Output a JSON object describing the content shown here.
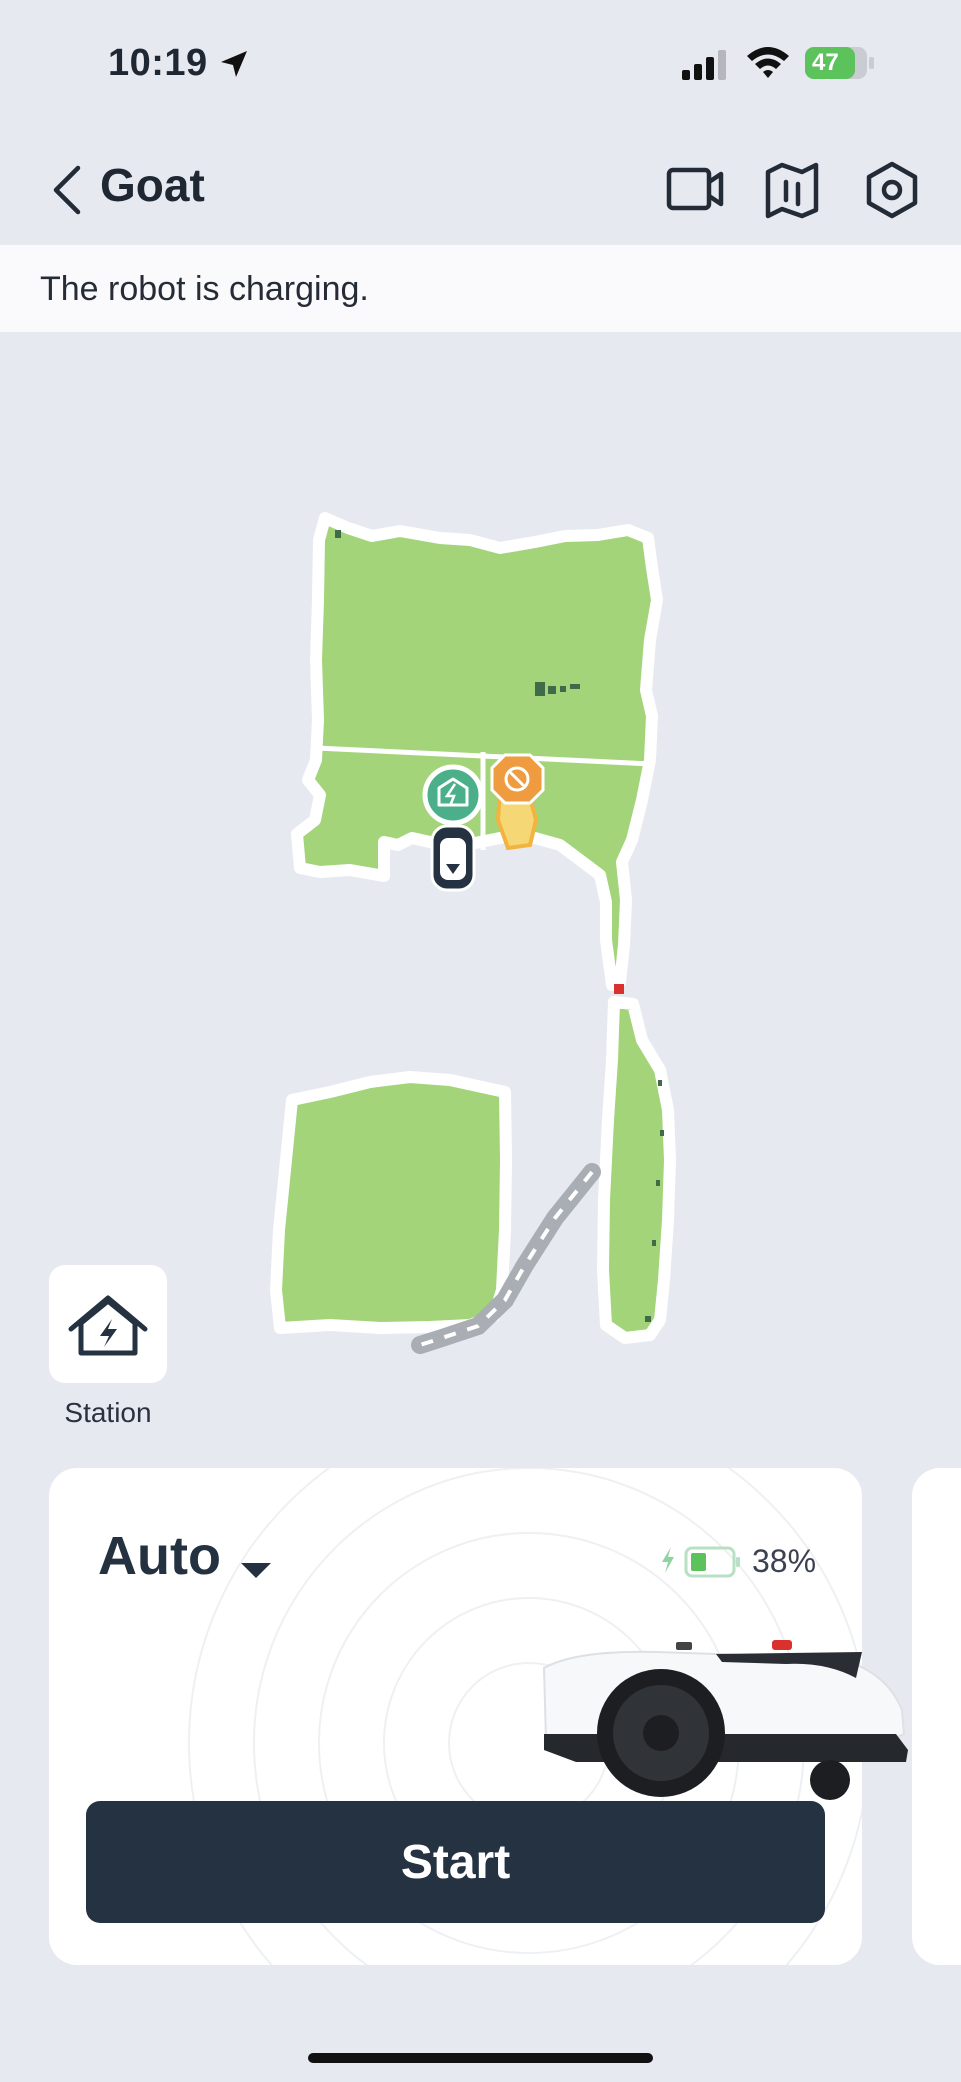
{
  "status_bar": {
    "time": "10:19",
    "battery_percent": "47"
  },
  "header": {
    "title": "Goat",
    "icons": {
      "back": "chevron-left-icon",
      "camera": "video-camera-icon",
      "map": "map-icon",
      "settings": "hexagon-gear-icon"
    }
  },
  "status_banner": {
    "text": "The robot is charging."
  },
  "map": {
    "lawn_color": "#a3d47a",
    "border_color": "#ffffff",
    "path_color": "#9ea3ab",
    "markers": [
      "charging-station-marker",
      "no-go-zone-marker",
      "robot-marker"
    ]
  },
  "station": {
    "label": "Station",
    "icon": "house-bolt-icon"
  },
  "mode_card": {
    "mode": "Auto",
    "battery_percent": "38%",
    "battery_level": 0.38,
    "start_label": "Start"
  },
  "colors": {
    "accent_dark": "#253241",
    "background": "#e7e9f1",
    "battery_green": "#5cc25c"
  }
}
